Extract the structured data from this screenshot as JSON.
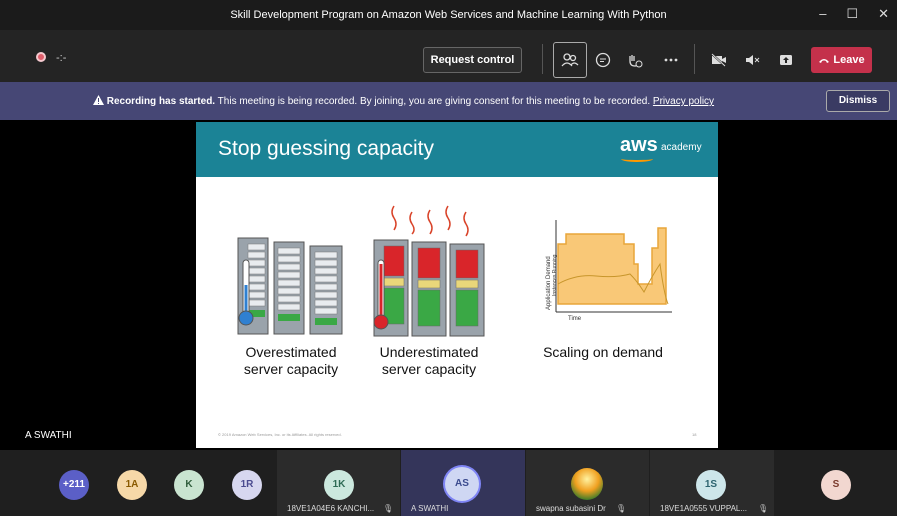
{
  "window": {
    "title": "Skill Development Program on Amazon Web Services and Machine Learning With Python",
    "minimize_glyph": "–",
    "maximize_glyph": "☐",
    "close_glyph": "✕"
  },
  "toolbar": {
    "timer": "-:-",
    "request_control_label": "Request control",
    "leave_label": "Leave",
    "icons": [
      "people-icon",
      "chat-icon",
      "reactions-icon",
      "more-icon",
      "camera-off-icon",
      "speaker-icon",
      "share-icon",
      "phone-icon"
    ]
  },
  "banner": {
    "bold_text": "Recording has started.",
    "message": " This meeting is being recorded. By joining, you are giving consent for this meeting to be recorded. ",
    "link": "Privacy policy",
    "dismiss_label": "Dismiss"
  },
  "slide": {
    "title": "Stop guessing capacity",
    "brand": "aws",
    "brand_sub": "academy",
    "caption1": "Overestimated server capacity",
    "caption2": "Underestimated server capacity",
    "caption3": "Scaling on demand",
    "chart_ylabel1": "Application Demand",
    "chart_ylabel2": "Instances Running",
    "chart_xlabel": "Time",
    "footer": "© 2019 Amazon Web Services, Inc. or its Affiliates. All rights reserved.",
    "page": "18"
  },
  "presenter_name": "A SWATHI",
  "participants": [
    {
      "initials": "+211",
      "color": "#5b5fc7",
      "text_color": "#ffffff"
    },
    {
      "initials": "1A",
      "color": "#f6d8a8",
      "text_color": "#8a5a00"
    },
    {
      "initials": "K",
      "color": "#c9e4d0",
      "text_color": "#2f5d3c"
    },
    {
      "initials": "1R",
      "color": "#d7d7ef",
      "text_color": "#4b4b8f"
    },
    {
      "initials": "1K",
      "color": "#cbe8de",
      "text_color": "#2e6b55",
      "name": "18VE1A04E6 KANCHI..."
    },
    {
      "initials": "AS",
      "color": "#cfd7f3",
      "text_color": "#3b4b8f",
      "name": "A SWATHI"
    },
    {
      "initials": "",
      "color": "#f0a020",
      "text_color": "#ffffff",
      "name": "swapna subasini Dr"
    },
    {
      "initials": "1S",
      "color": "#cde6ea",
      "text_color": "#2d6470",
      "name": "18VE1A0555 VUPPAL..."
    },
    {
      "initials": "S",
      "color": "#f2d7d0",
      "text_color": "#7a3a2c"
    }
  ]
}
